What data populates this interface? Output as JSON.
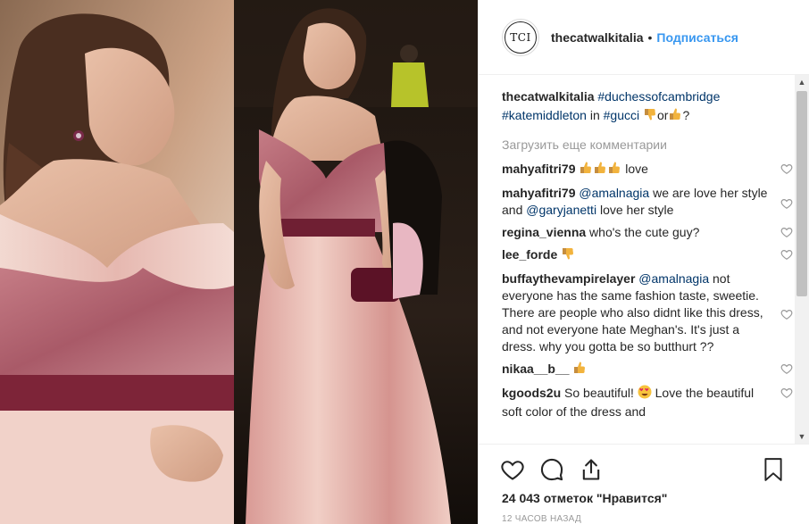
{
  "header": {
    "avatar_text": "TCI",
    "username": "thecatwalkitalia",
    "separator": "•",
    "follow_label": "Подписаться"
  },
  "caption": {
    "username": "thecatwalkitalia",
    "tag1": "#duchessofcambridge",
    "tag2": "#katemiddleton",
    "in_text": "in",
    "tag3": "#gucci",
    "or_text": "or",
    "question": "?"
  },
  "load_more": "Загрузить еще комментарии",
  "comments": [
    {
      "user": "mahyafitri79",
      "text": "love"
    },
    {
      "user": "mahyafitri79",
      "mention1": "@amalnagia",
      "text1": "we are love her style and",
      "mention2": "@garyjanetti",
      "text2": "love her style"
    },
    {
      "user": "regina_vienna",
      "text": "who's the cute guy?"
    },
    {
      "user": "lee_forde",
      "text": ""
    },
    {
      "user": "buffaythevampirelayer",
      "mention": "@amalnagia",
      "text": "not everyone has the same fashion taste, sweetie. There are people who also didnt like this dress, and not everyone hate Meghan's. It's just a dress. why you gotta be so butthurt ??"
    },
    {
      "user": "nikaa__b__",
      "text": ""
    },
    {
      "user": "kgoods2u",
      "text1": "So beautiful!",
      "text2": "Love the beautiful soft color of the dress and"
    }
  ],
  "likes": "24 043 отметок \"Нравится\"",
  "timestamp": "12 ЧАСОВ НАЗАД",
  "icons": {
    "like": "heart-icon",
    "comment": "comment-icon",
    "share": "share-icon",
    "save": "bookmark-icon"
  },
  "colors": {
    "link": "#003569",
    "follow": "#3897f0",
    "muted": "#999999"
  }
}
